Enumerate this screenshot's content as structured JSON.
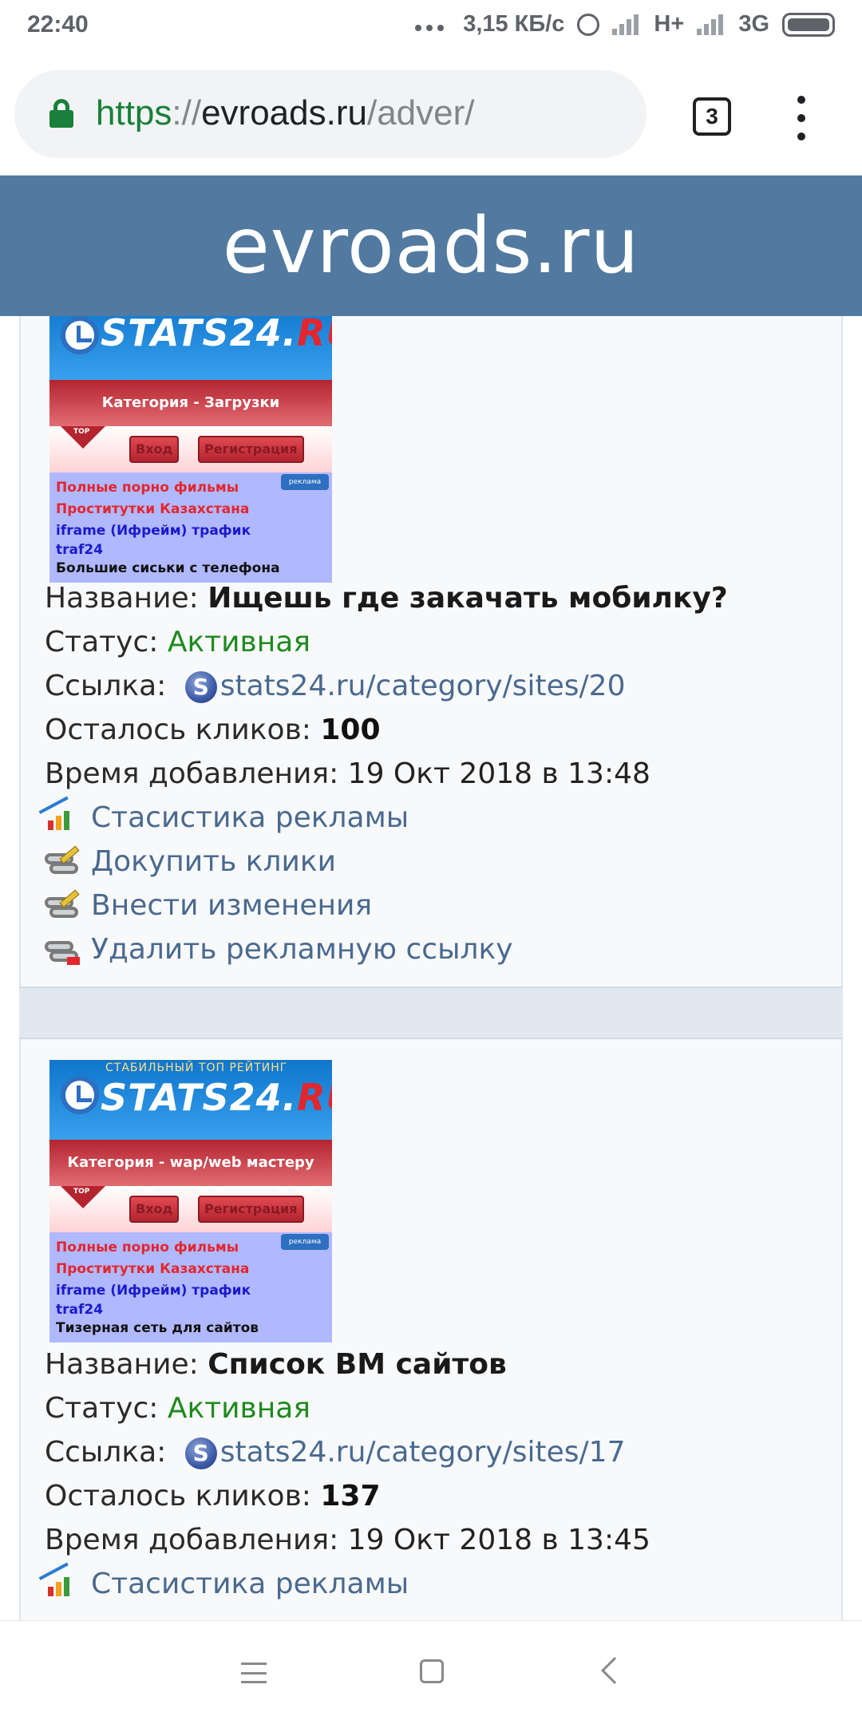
{
  "status_bar": {
    "time": "22:40",
    "speed": "3,15 КБ/с",
    "network1": "H+",
    "network2": "3G"
  },
  "browser": {
    "url_scheme": "https",
    "url_sep": "://",
    "url_host": "evroads.ru",
    "url_path": "/adver/",
    "tab_count": "3"
  },
  "site": {
    "title": "evroads.ru"
  },
  "labels": {
    "name": "Название: ",
    "status": "Статус: ",
    "link": "Ссылка: ",
    "clicks_left": "Осталось кликов: ",
    "added": "Время добавления: "
  },
  "ads": [
    {
      "banner": {
        "top_text": "",
        "logo": "STATS24.",
        "logo_ru": "RU",
        "category": "Категория - Загрузки",
        "badge": "TOP",
        "login": "Вход",
        "register": "Регистрация",
        "promo": "рекламa",
        "lines": [
          "Полные порно фильмы",
          "Проститутки Казахстана",
          "iframe (Ифрейм) трафик",
          "traf24",
          "Большие сиськи с телефона"
        ]
      },
      "name": "Ищешь где закачать мобилку?",
      "status": "Активная",
      "link": "stats24.ru/category/sites/20",
      "clicks": "100",
      "added": "19 Окт 2018 в 13:48",
      "actions": [
        "Стасистика рекламы",
        "Докупить клики",
        "Внести изменения",
        "Удалить рекламную ссылку"
      ]
    },
    {
      "banner": {
        "top_text": "СТАБИЛЬНЫЙ ТОП РЕЙТИНГ",
        "logo": "STATS24.",
        "logo_ru": "RU",
        "category": "Категория - wap/web мастеру",
        "badge": "TOP",
        "login": "Вход",
        "register": "Регистрация",
        "promo": "рекламa",
        "lines": [
          "Полные порно фильмы",
          "Проститутки Казахстана",
          "iframe (Ифрейм) трафик",
          "traf24",
          "Тизерная сеть для сайтов"
        ]
      },
      "name": "Список ВМ сайтов",
      "status": "Активная",
      "link": "stats24.ru/category/sites/17",
      "clicks": "137",
      "added": "19 Окт 2018 в 13:45",
      "actions": [
        "Стасистика рекламы"
      ]
    }
  ],
  "colors": {
    "header_bg": "#527aa0",
    "status_active": "#1e8a1e",
    "link": "#4a6a8f",
    "url_scheme": "#188038"
  },
  "icons": {
    "lock": "lock-icon",
    "stats": "chart-icon",
    "buy": "link-edit-icon",
    "edit": "link-edit-icon",
    "delete": "link-delete-icon",
    "site": "stats24-favicon-icon"
  }
}
